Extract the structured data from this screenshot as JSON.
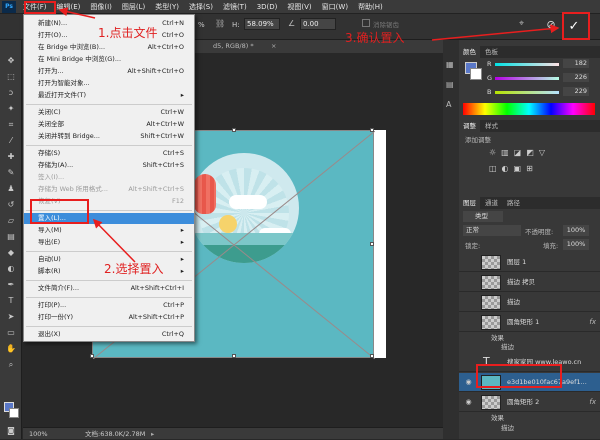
{
  "menubar": {
    "items": [
      "文件(F)",
      "编辑(E)",
      "图像(I)",
      "图层(L)",
      "类型(Y)",
      "选择(S)",
      "滤镜(T)",
      "3D(D)",
      "视图(V)",
      "窗口(W)",
      "帮助(H)"
    ],
    "logo": "Ps"
  },
  "options": {
    "h_label": "H:",
    "h_value": "58.09%",
    "rot_value": "0.00",
    "antialias": "消除锯齿",
    "zoom_prefix": "%"
  },
  "doc": {
    "tab": "d5, RGB/8) *",
    "zoom": "100%",
    "doc_info": "文档:638.0K/2.78M"
  },
  "file_menu": [
    {
      "label": "新建(N)...",
      "shortcut": "Ctrl+N",
      "state": "normal"
    },
    {
      "label": "打开(O)...",
      "shortcut": "Ctrl+O",
      "state": "normal"
    },
    {
      "label": "在 Bridge 中浏览(B)...",
      "shortcut": "Alt+Ctrl+O",
      "state": "normal"
    },
    {
      "label": "在 Mini Bridge 中浏览(G)...",
      "shortcut": "",
      "state": "normal"
    },
    {
      "label": "打开为...",
      "shortcut": "Alt+Shift+Ctrl+O",
      "state": "normal"
    },
    {
      "label": "打开为智能对象...",
      "shortcut": "",
      "state": "normal"
    },
    {
      "label": "最近打开文件(T)",
      "shortcut": "▸",
      "state": "normal"
    },
    {
      "label": "关闭(C)",
      "shortcut": "Ctrl+W",
      "state": "normal"
    },
    {
      "label": "关闭全部",
      "shortcut": "Alt+Ctrl+W",
      "state": "normal"
    },
    {
      "label": "关闭并转到 Bridge...",
      "shortcut": "Shift+Ctrl+W",
      "state": "normal"
    },
    {
      "label": "存储(S)",
      "shortcut": "Ctrl+S",
      "state": "normal"
    },
    {
      "label": "存储为(A)...",
      "shortcut": "Shift+Ctrl+S",
      "state": "normal"
    },
    {
      "label": "签入(I)...",
      "shortcut": "",
      "state": "disabled"
    },
    {
      "label": "存储为 Web 所用格式...",
      "shortcut": "Alt+Shift+Ctrl+S",
      "state": "disabled"
    },
    {
      "label": "恢复(V)",
      "shortcut": "F12",
      "state": "disabled"
    },
    {
      "label": "置入(L)...",
      "shortcut": "",
      "state": "highlight"
    },
    {
      "label": "导入(M)",
      "shortcut": "▸",
      "state": "normal"
    },
    {
      "label": "导出(E)",
      "shortcut": "▸",
      "state": "normal"
    },
    {
      "label": "自动(U)",
      "shortcut": "▸",
      "state": "normal"
    },
    {
      "label": "脚本(R)",
      "shortcut": "▸",
      "state": "normal"
    },
    {
      "label": "文件简介(F)...",
      "shortcut": "Alt+Shift+Ctrl+I",
      "state": "normal"
    },
    {
      "label": "打印(P)...",
      "shortcut": "Ctrl+P",
      "state": "normal"
    },
    {
      "label": "打印一份(Y)",
      "shortcut": "Alt+Shift+Ctrl+P",
      "state": "normal"
    },
    {
      "label": "退出(X)",
      "shortcut": "Ctrl+Q",
      "state": "normal"
    }
  ],
  "annotations": {
    "step1": "1.点击文件",
    "step2": "2.选择置入",
    "step3": "3.确认置入"
  },
  "color_panel": {
    "tab1": "颜色",
    "tab2": "色板",
    "r": "R",
    "g": "G",
    "b": "B",
    "r_val": "182",
    "g_val": "226",
    "b_val": "229",
    "fg": "#5a78c8"
  },
  "adjust_panel": {
    "tab1": "调整",
    "tab2": "样式",
    "title": "添加调整"
  },
  "layers_panel": {
    "tab1": "图层",
    "tab2": "通道",
    "tab3": "路径",
    "kind": "类型",
    "blend": "正常",
    "opacity_label": "不透明度:",
    "opacity": "100%",
    "lock_label": "锁定:",
    "fill_label": "填充:",
    "fill": "100%",
    "layers": [
      {
        "name": "图层 1",
        "fx": "",
        "visible": false
      },
      {
        "name": "描边 拷贝",
        "fx": "",
        "visible": false
      },
      {
        "name": "描边",
        "fx": "",
        "visible": false
      },
      {
        "name": "圆角矩形 1",
        "fx": "fx",
        "visible": false
      },
      {
        "name": "搜家家园 www.leawo.cn",
        "fx": "",
        "visible": false
      },
      {
        "name": "e3d1be010fac67a9ef1...",
        "fx": "",
        "visible": true
      },
      {
        "name": "圆角矩形 2",
        "fx": "fx",
        "visible": true
      }
    ],
    "effects_label": "效果",
    "stroke_label": "描边",
    "text_icon": "T"
  },
  "colors": {
    "accent": "#3c8ddb",
    "annotation": "#e81e1e",
    "teal": "#5bb8c2"
  }
}
